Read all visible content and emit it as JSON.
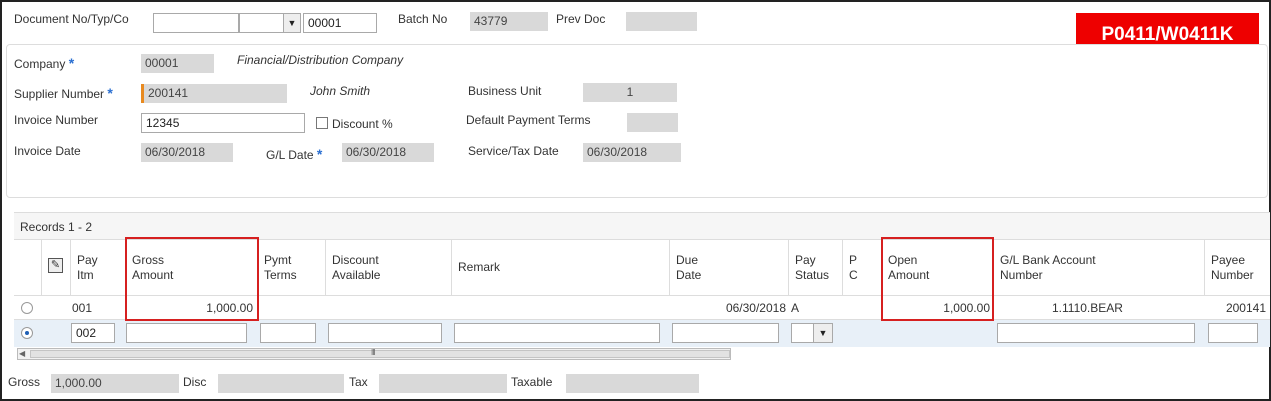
{
  "header": {
    "doc_label": "Document No/Typ/Co",
    "doc_company": "00001",
    "batch_label": "Batch No",
    "batch_value": "43779",
    "prev_doc_label": "Prev Doc",
    "badge": "P0411/W0411K"
  },
  "form": {
    "company_label": "Company",
    "company_value": "00001",
    "company_name": "Financial/Distribution Company",
    "supplier_label": "Supplier Number",
    "supplier_value": "200141",
    "supplier_name": "John Smith",
    "business_unit_label": "Business Unit",
    "business_unit_value": "1",
    "invoice_number_label": "Invoice Number",
    "invoice_number_value": "12345",
    "discount_label": "Discount %",
    "default_terms_label": "Default Payment Terms",
    "invoice_date_label": "Invoice Date",
    "invoice_date_value": "06/30/2018",
    "gl_date_label": "G/L Date",
    "gl_date_value": "06/30/2018",
    "service_date_label": "Service/Tax Date",
    "service_date_value": "06/30/2018"
  },
  "grid": {
    "records": "Records 1 - 2",
    "columns": {
      "pay_itm": [
        "Pay",
        "Itm"
      ],
      "gross": [
        "Gross",
        "Amount"
      ],
      "pymt": [
        "Pymt",
        "Terms"
      ],
      "discount": [
        "Discount",
        "Available"
      ],
      "remark": "Remark",
      "due": [
        "Due",
        "Date"
      ],
      "pay_status": [
        "Pay",
        "Status"
      ],
      "pc": [
        "P",
        "C"
      ],
      "open": [
        "Open",
        "Amount"
      ],
      "glbank": [
        "G/L Bank Account",
        "Number"
      ],
      "payee": [
        "Payee",
        "Number"
      ]
    },
    "rows": [
      {
        "pay_itm": "001",
        "gross": "1,000.00",
        "due": "06/30/2018",
        "pay_status": "A",
        "open": "1,000.00",
        "glbank": "1.1110.BEAR",
        "payee": "200141"
      },
      {
        "pay_itm": "002"
      }
    ],
    "scroll_grip": "III"
  },
  "totals": {
    "gross_label": "Gross",
    "gross_value": "1,000.00",
    "disc_label": "Disc",
    "tax_label": "Tax",
    "taxable_label": "Taxable"
  },
  "icons": {
    "column_settings": "pencil-grid-icon",
    "dropdown": "chevron-down-icon",
    "required": "asterisk-icon"
  },
  "colors": {
    "badge_bg": "#ee0000",
    "highlight_box": "#d62020",
    "required_star": "#2a6fd1"
  }
}
